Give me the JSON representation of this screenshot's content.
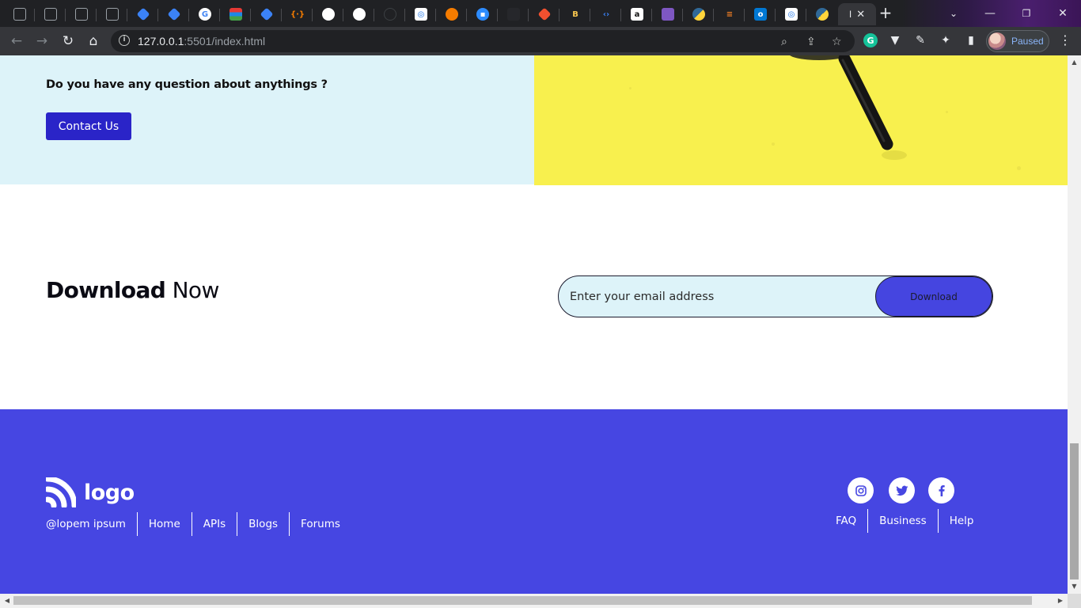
{
  "browser": {
    "tabs": [
      {
        "icon": "blank-icon",
        "color": "#202124"
      },
      {
        "icon": "blank-icon",
        "color": "#202124"
      },
      {
        "icon": "blank-icon",
        "color": "#202124"
      },
      {
        "icon": "blank-icon",
        "color": "#202124"
      },
      {
        "icon": "diamond-icon",
        "color": "#3b82f6"
      },
      {
        "icon": "diamond-icon",
        "color": "#3b82f6"
      },
      {
        "icon": "google-icon",
        "color": "#ffffff"
      },
      {
        "icon": "stack-icon",
        "color": "#e53935"
      },
      {
        "icon": "diamond-icon",
        "color": "#3b82f6"
      },
      {
        "icon": "json-icon",
        "color": "#f57c00"
      },
      {
        "icon": "globe-icon",
        "color": "#ffffff"
      },
      {
        "icon": "globe-icon",
        "color": "#ffffff"
      },
      {
        "icon": "github-icon",
        "color": "#202124"
      },
      {
        "icon": "camera-icon",
        "color": "#ffffff"
      },
      {
        "icon": "orange-circle-icon",
        "color": "#f57c00"
      },
      {
        "icon": "video-icon",
        "color": "#2d8cff"
      },
      {
        "icon": "dark-app-icon",
        "color": "#202124"
      },
      {
        "icon": "git-icon",
        "color": "#f1502f"
      },
      {
        "icon": "b-icon",
        "color": "#202124"
      },
      {
        "icon": "code-icon",
        "color": "#3b82f6"
      },
      {
        "icon": "amazon-icon",
        "color": "#ffffff"
      },
      {
        "icon": "purple-app-icon",
        "color": "#7e57c2"
      },
      {
        "icon": "python-icon",
        "color": "#306998"
      },
      {
        "icon": "stackoverflow-icon",
        "color": "#f48024"
      },
      {
        "icon": "outlook-icon",
        "color": "#0078d4"
      },
      {
        "icon": "camera-icon",
        "color": "#ffffff"
      },
      {
        "icon": "python-icon",
        "color": "#306998"
      }
    ],
    "active_tab_label": "I",
    "active_tab_close": "✕",
    "new_tab": "+",
    "url_host": "127.0.0.1",
    "url_rest": ":5501/index.html",
    "profile_status": "Paused"
  },
  "contact": {
    "question": "Do you have any question about anythings ?",
    "button_label": "Contact Us",
    "image_bg": "#f8f04e"
  },
  "download": {
    "title_bold": "Download",
    "title_rest": " Now",
    "email_placeholder": "Enter your email address",
    "button_label": "Download",
    "accent": "#4545e0"
  },
  "footer": {
    "bg": "#4646e2",
    "logo_text": "logo",
    "left_links": [
      "@lopem ipsum",
      "Home",
      "APIs",
      "Blogs",
      "Forums"
    ],
    "right_links": [
      "FAQ",
      "Business",
      "Help"
    ],
    "social": [
      "instagram-icon",
      "twitter-icon",
      "facebook-icon"
    ]
  }
}
